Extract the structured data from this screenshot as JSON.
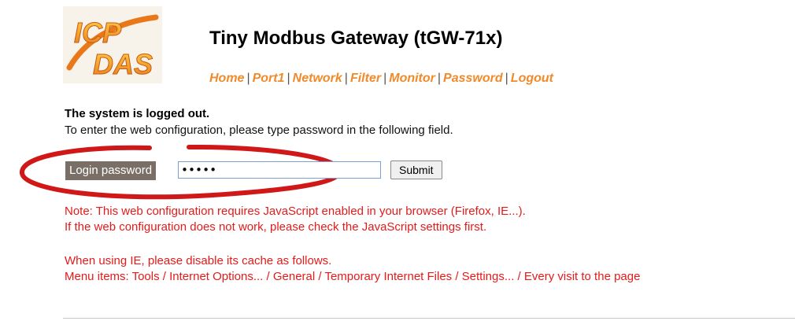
{
  "header": {
    "logo_text": "ICP DAS",
    "title": "Tiny Modbus Gateway (tGW-71x)"
  },
  "nav": {
    "items": [
      {
        "label": "Home"
      },
      {
        "label": "Port1"
      },
      {
        "label": "Network"
      },
      {
        "label": "Filter"
      },
      {
        "label": "Monitor"
      },
      {
        "label": "Password"
      },
      {
        "label": "Logout"
      }
    ],
    "separator": "|"
  },
  "status": {
    "heading": "The system is logged out.",
    "instruction": "To enter the web configuration, please type password in the following field."
  },
  "login": {
    "label": "Login password",
    "value": "•••••",
    "submit_label": "Submit"
  },
  "notes": {
    "line1": "Note: This web configuration requires JavaScript enabled in your browser (Firefox, IE...).",
    "line2": "If the web configuration does not work, please check the JavaScript settings first.",
    "line3": "When using IE, please disable its cache as follows.",
    "line4": "Menu items: Tools / Internet Options... / General / Temporary Internet Files / Settings... / Every visit to the page"
  },
  "colors": {
    "nav_link": "#f08a2a",
    "note_text": "#e51a1a",
    "highlight_ellipse": "#d01818",
    "label_background": "#7a6f66"
  }
}
